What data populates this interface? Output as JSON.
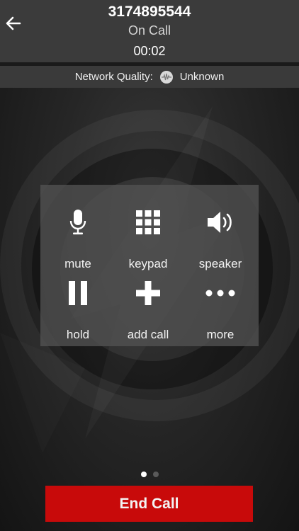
{
  "header": {
    "caller_number": "3174895544",
    "call_status": "On Call",
    "call_timer": "00:02",
    "back_icon": "arrow-left-icon"
  },
  "network": {
    "label": "Network Quality:",
    "value": "Unknown",
    "icon": "signal-wave-icon"
  },
  "controls": [
    {
      "label": "mute",
      "icon": "microphone-icon"
    },
    {
      "label": "keypad",
      "icon": "keypad-grid-icon"
    },
    {
      "label": "speaker",
      "icon": "speaker-icon"
    },
    {
      "label": "hold",
      "icon": "pause-icon"
    },
    {
      "label": "add call",
      "icon": "plus-icon"
    },
    {
      "label": "more",
      "icon": "more-dots-icon"
    }
  ],
  "pager": {
    "pages": 2,
    "active": 1
  },
  "end_call": {
    "label": "End Call"
  },
  "colors": {
    "end_call": "#c80a0a",
    "header": "#3b3b3b",
    "panel": "#525252"
  }
}
